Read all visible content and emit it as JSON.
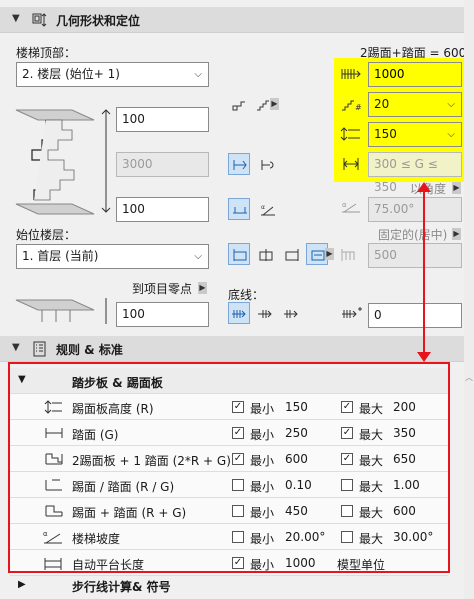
{
  "geo": {
    "title": "几何形状和定位",
    "stair_top_label": "楼梯顶部：",
    "stair_top_value": "2. 楼层 (始位+ 1)",
    "top_offset": "100",
    "height_value": "3000",
    "bottom_offset": "100",
    "base_story_label": "始位楼层：",
    "base_story_value": "1. 首层 (当前)",
    "ref_point_label": "到项目零点",
    "ref_value": "100",
    "formula": "2踢面+踏面 = 600",
    "flight_length": "1000",
    "riser_count": "20",
    "riser_height": "150",
    "going_range": "300 ≤ G ≤ 350",
    "by_angle_label": "以角度",
    "angle_value": "75.00°",
    "fixed_label": "固定的(居中)",
    "fixed_value": "500",
    "baseline_label": "底线：",
    "baseline_value": "0"
  },
  "rules": {
    "title": "规则 & 标准",
    "group_title": "踏步板 & 踢面板",
    "min_label": "最小",
    "max_label": "最大",
    "rows": [
      {
        "icon": "riser-height-icon",
        "name": "踢面板高度 (R)",
        "min_checked": true,
        "min": "150",
        "max_checked": true,
        "max": "200"
      },
      {
        "icon": "tread-depth-icon",
        "name": "踏面 (G)",
        "min_checked": true,
        "min": "250",
        "max_checked": true,
        "max": "350"
      },
      {
        "icon": "two-riser-icon",
        "name": "2踢面板 + 1 踏面 (2*R + G)",
        "min_checked": true,
        "min": "600",
        "max_checked": true,
        "max": "650"
      },
      {
        "icon": "ratio-icon",
        "name": "踢面 / 踏面 (R / G)",
        "min_checked": false,
        "min": "0.10",
        "max_checked": false,
        "max": "1.00"
      },
      {
        "icon": "sum-icon",
        "name": "踢面 + 踏面 (R + G)",
        "min_checked": false,
        "min": "450",
        "max_checked": false,
        "max": "600"
      },
      {
        "icon": "slope-icon",
        "name": "楼梯坡度",
        "min_checked": false,
        "min": "20.00°",
        "max_checked": false,
        "max": "30.00°"
      },
      {
        "icon": "landing-icon",
        "name": "自动平台长度",
        "min_checked": true,
        "min": "1000",
        "max_text": "模型单位"
      }
    ],
    "next_group": "步行线计算& 符号"
  },
  "colors": {
    "highlight": "#ffff00",
    "annotation": "#e8141b",
    "selected": "#cfe3f7"
  }
}
